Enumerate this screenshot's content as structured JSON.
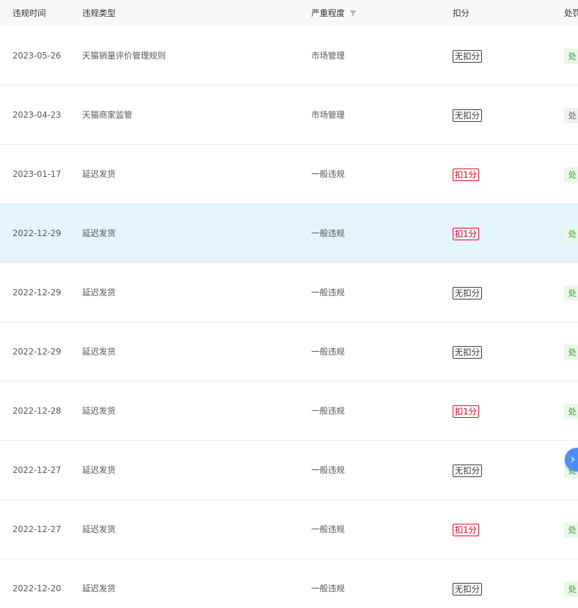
{
  "header": {
    "col_time": "违规时间",
    "col_type": "违规类型",
    "col_severity": "严重程度",
    "col_score": "扣分",
    "col_status": "处罚"
  },
  "rows": [
    {
      "time": "2023-05-26",
      "type": "天猫销量评价管理规则",
      "severity": "市场管理",
      "score": "无扣分",
      "score_kind": "none",
      "status": "处",
      "status_kind": "green"
    },
    {
      "time": "2023-04-23",
      "type": "天猫商家监管",
      "severity": "市场管理",
      "score": "无扣分",
      "score_kind": "none",
      "status": "处",
      "status_kind": "grey"
    },
    {
      "time": "2023-01-17",
      "type": "延迟发货",
      "severity": "一般违规",
      "score": "扣1分",
      "score_kind": "deduct",
      "status": "处",
      "status_kind": "green"
    },
    {
      "time": "2022-12-29",
      "type": "延迟发货",
      "severity": "一般违规",
      "score": "扣1分",
      "score_kind": "deduct",
      "status": "处",
      "status_kind": "green"
    },
    {
      "time": "2022-12-29",
      "type": "延迟发货",
      "severity": "一般违规",
      "score": "无扣分",
      "score_kind": "none",
      "status": "处",
      "status_kind": "green"
    },
    {
      "time": "2022-12-29",
      "type": "延迟发货",
      "severity": "一般违规",
      "score": "无扣分",
      "score_kind": "none",
      "status": "处",
      "status_kind": "green"
    },
    {
      "time": "2022-12-28",
      "type": "延迟发货",
      "severity": "一般违规",
      "score": "扣1分",
      "score_kind": "deduct",
      "status": "处",
      "status_kind": "green"
    },
    {
      "time": "2022-12-27",
      "type": "延迟发货",
      "severity": "一般违规",
      "score": "无扣分",
      "score_kind": "none",
      "status": "处",
      "status_kind": "green"
    },
    {
      "time": "2022-12-27",
      "type": "延迟发货",
      "severity": "一般违规",
      "score": "扣1分",
      "score_kind": "deduct",
      "status": "处",
      "status_kind": "green"
    },
    {
      "time": "2022-12-20",
      "type": "延迟发货",
      "severity": "一般违规",
      "score": "无扣分",
      "score_kind": "none",
      "status": "处",
      "status_kind": "green"
    }
  ],
  "highlighted_row": 3,
  "icons": {
    "filter": "filter-icon",
    "scroll": "chevron-right-icon",
    "scroll_glyph": "›"
  },
  "colors": {
    "deduct": "#e0001f",
    "status_green": "#2da641",
    "highlight": "#e3f4fc",
    "accent": "#4a8ff7"
  }
}
